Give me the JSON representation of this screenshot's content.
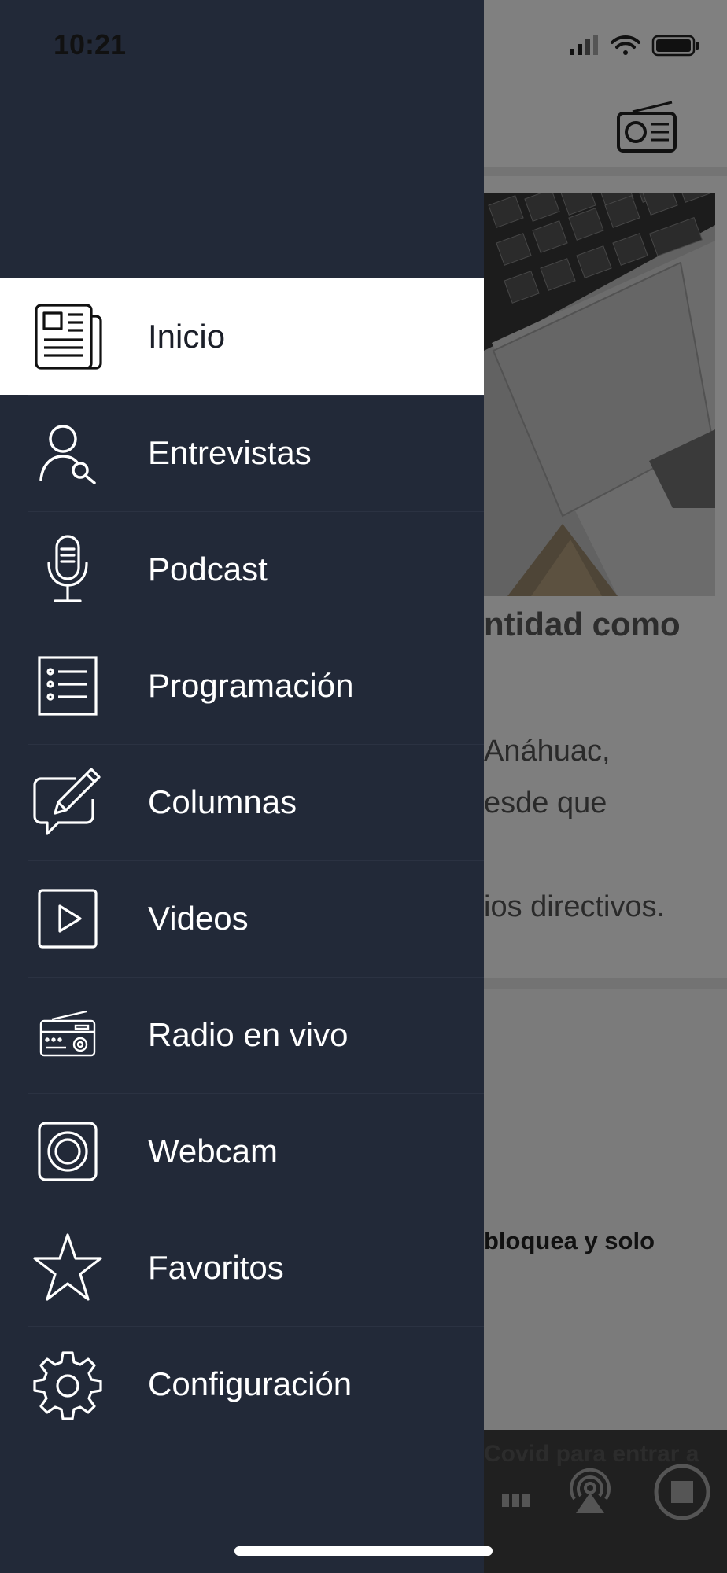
{
  "status_bar": {
    "time": "10:21"
  },
  "background": {
    "article_title": "ntidad como",
    "article_lines": [
      " Anáhuac,",
      "esde que",
      "",
      "ios directivos."
    ],
    "card2_title": "bloquea y solo",
    "player_ticker": "Covid para entrar a"
  },
  "menu": {
    "items": [
      {
        "label": "Inicio",
        "icon": "newspaper-icon",
        "active": true
      },
      {
        "label": "Entrevistas",
        "icon": "user-search-icon",
        "active": false
      },
      {
        "label": "Podcast",
        "icon": "microphone-icon",
        "active": false
      },
      {
        "label": "Programación",
        "icon": "list-icon",
        "active": false
      },
      {
        "label": "Columnas",
        "icon": "pencil-chat-icon",
        "active": false
      },
      {
        "label": "Videos",
        "icon": "play-icon",
        "active": false
      },
      {
        "label": "Radio en vivo",
        "icon": "radio-icon",
        "active": false
      },
      {
        "label": "Webcam",
        "icon": "webcam-icon",
        "active": false
      },
      {
        "label": "Favoritos",
        "icon": "star-icon",
        "active": false
      },
      {
        "label": "Configuración",
        "icon": "gear-icon",
        "active": false
      }
    ]
  },
  "colors": {
    "drawer_bg": "#222938",
    "active_bg": "#ffffff",
    "active_text": "#1b1f29",
    "menu_text": "#ffffff"
  }
}
